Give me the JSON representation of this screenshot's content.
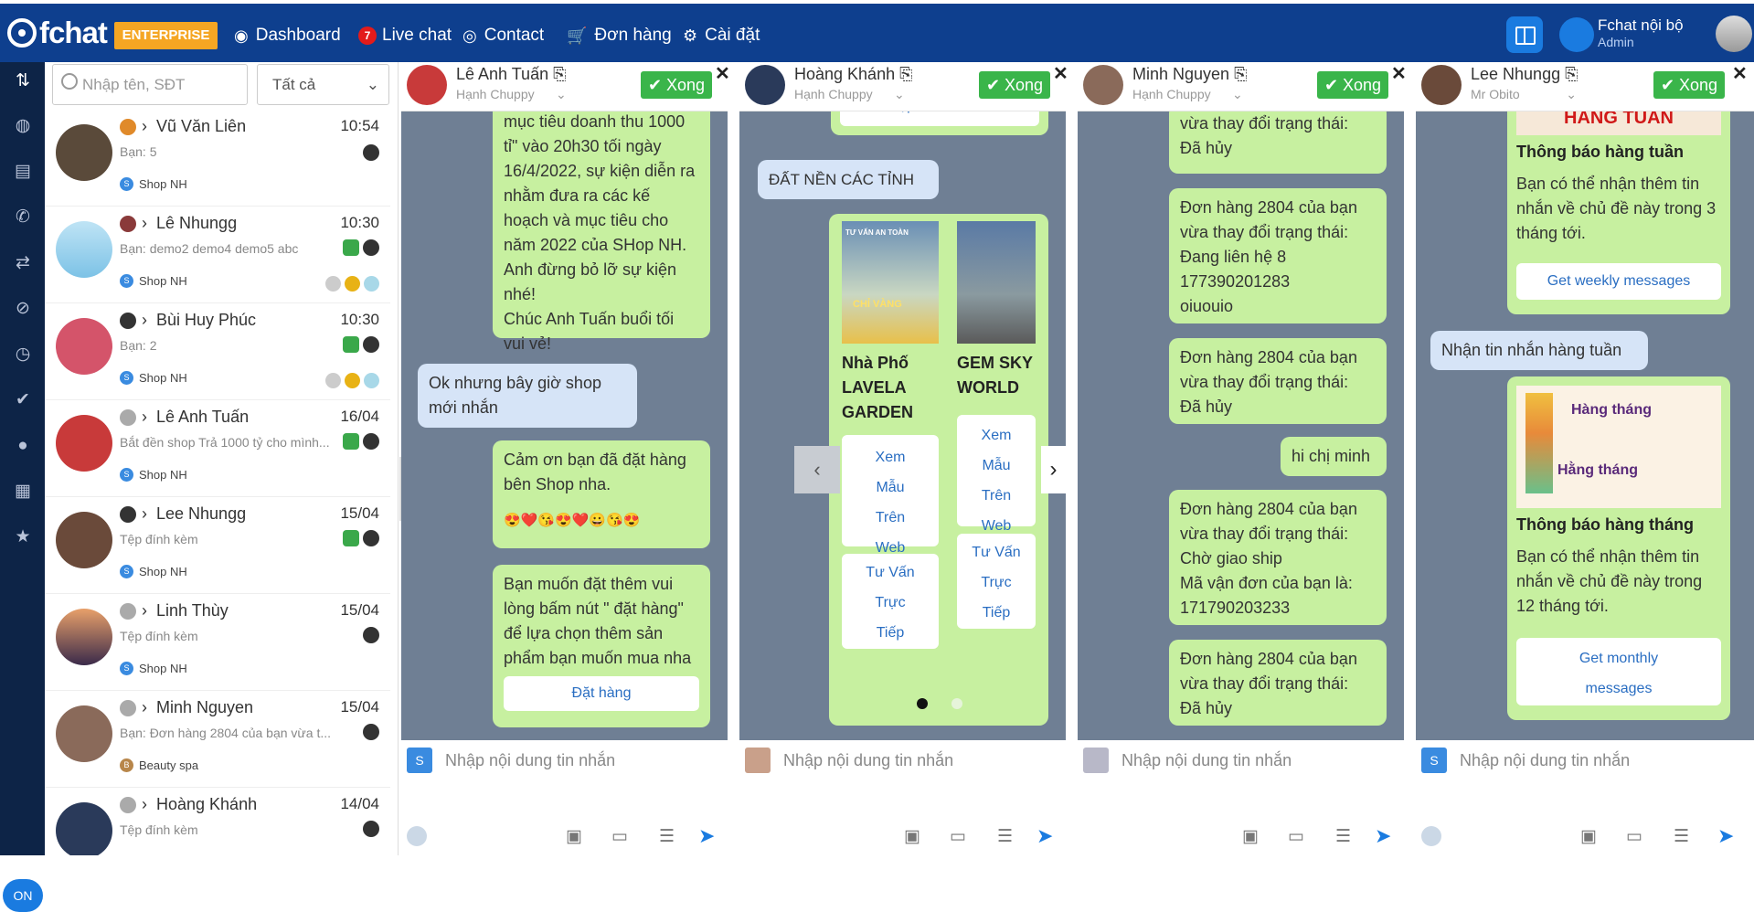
{
  "topbar": {
    "logo": "fchat",
    "edition": "ENTERPRISE",
    "nav": [
      {
        "label": "Dashboard",
        "icon": "dashboard-icon"
      },
      {
        "label": "Live chat",
        "icon": "chat-icon",
        "badge": "7"
      },
      {
        "label": "Contact",
        "icon": "user-circle-icon"
      },
      {
        "label": "Đơn hàng",
        "icon": "cart-icon"
      },
      {
        "label": "Cài đặt",
        "icon": "gear-icon"
      }
    ],
    "account_name": "Fchat nội bộ",
    "account_role": "Admin"
  },
  "sidebar": {
    "on_label": "ON"
  },
  "convlist": {
    "search_placeholder": "Nhập tên, SĐT",
    "filter_value": "Tất cả",
    "items": [
      {
        "name": "Vũ Văn Liên",
        "time": "10:54",
        "preview": "Bạn: 5",
        "shop": "Shop NH"
      },
      {
        "name": "Lê Nhungg",
        "time": "10:30",
        "preview": "Bạn: demo2 demo4 demo5 abc",
        "shop": "Shop NH"
      },
      {
        "name": "Bùi Huy Phúc",
        "time": "10:30",
        "preview": "Bạn: 2",
        "shop": "Shop NH"
      },
      {
        "name": "Lê Anh Tuấn",
        "time": "16/04",
        "preview": "Bắt đền shop Trả 1000 tỷ cho mình...",
        "shop": "Shop NH"
      },
      {
        "name": "Lee Nhungg",
        "time": "15/04",
        "preview": "Tệp đính kèm",
        "shop": "Shop NH"
      },
      {
        "name": "Linh Thùy",
        "time": "15/04",
        "preview": "Tệp đính kèm",
        "shop": "Shop NH"
      },
      {
        "name": "Minh Nguyen",
        "time": "15/04",
        "preview": "Bạn: Đơn hàng 2804 của bạn vừa t...",
        "shop": "Beauty spa"
      },
      {
        "name": "Hoàng Khánh",
        "time": "14/04",
        "preview": "Tệp đính kèm",
        "shop": ""
      }
    ]
  },
  "panels": [
    {
      "name": "Lê Anh Tuấn",
      "sub": "Hạnh Chuppy",
      "done": "✔ Xong",
      "input_placeholder": "Nhập nội dung tin nhắn",
      "msgs": {
        "m1": "mục tiêu doanh thu 1000 tỉ\" vào 20h30 tối ngày 16/4/2022, sự kiện diễn ra nhằm đưa ra các kế hoạch và mục tiêu cho năm 2022 của SHop NH. Anh đừng bỏ lỡ sự kiện nhé!\nChúc Anh Tuấn buổi tối vui vẻ!",
        "m2": "Ok nhưng bây giờ shop mới nhắn",
        "m3": "Cảm ơn bạn đã đặt hàng bên Shop nha.",
        "m3e": "😍❤️😘😍❤️😀😘😍",
        "m4": "Bạn muốn đặt thêm vui lòng bấm nút \" đặt hàng\" để lựa chọn thêm sản phẩm bạn muốn mua nha",
        "m4btn": "Đặt hàng"
      }
    },
    {
      "name": "Hoàng Khánh",
      "sub": "Hạnh Chuppy",
      "done": "✔ Xong",
      "input_placeholder": "Nhập nội dung tin nhắn",
      "msgs": {
        "top": "Gặp NV Tư Vấn",
        "in1": "ĐẤT NỀN CÁC TỈNH",
        "c1title": "Nhà Phố LAVELA GARDEN",
        "c2title": "GEM SKY WORLD",
        "b1": "Xem Mẫu Trên Web",
        "b2": "Tư Vấn Trực Tiếp",
        "img1": "TƯ VẤN AN TOÀN",
        "img1b": "CHỈ VÀNG"
      }
    },
    {
      "name": "Minh Nguyen",
      "sub": "Hạnh Chuppy",
      "done": "✔ Xong",
      "input_placeholder": "Nhập nội dung tin nhắn",
      "msgs": {
        "a": "vừa thay đổi trạng thái:\nĐã hủy",
        "b": "Đơn hàng 2804 của bạn vừa thay đổi trạng thái:\nĐang liên hệ 8\n177390201283\noiuouio",
        "c": "Đơn hàng 2804 của bạn vừa thay đổi trạng thái:\nĐã hủy",
        "d": "hi chị minh",
        "e": "Đơn hàng 2804 của bạn vừa thay đổi trạng thái:\nChờ giao ship\nMã vận đơn của bạn là:\n171790203233",
        "f": "Đơn hàng 2804 của bạn vừa thay đổi trạng thái:\nĐã hủy"
      }
    },
    {
      "name": "Lee Nhungg",
      "sub": "Mr Obito",
      "done": "✔ Xong",
      "input_placeholder": "Nhập nội dung tin nhắn",
      "msgs": {
        "banner1": "HÀNG TUẦN",
        "t1": "Thông báo hàng tuần",
        "d1": "Bạn có thể nhận thêm tin nhắn về chủ đề này trong 3 tháng tới.",
        "b1": "Get weekly messages",
        "in": "Nhận tin nhắn hàng tuần",
        "img2a": "Hàng tháng",
        "img2b": "Hằng tháng",
        "t2": "Thông báo hàng tháng",
        "d2": "Bạn có thể nhận thêm tin nhắn về chủ đề này trong 12 tháng tới.",
        "b2": "Get monthly messages"
      }
    }
  ]
}
